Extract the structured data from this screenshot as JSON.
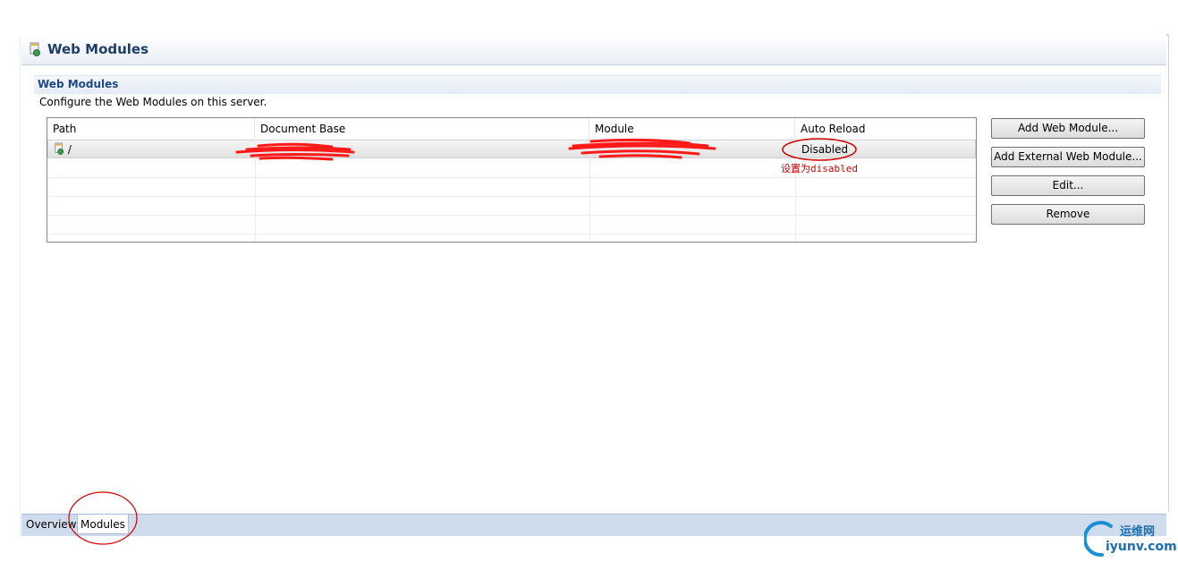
{
  "header": {
    "title": "Web Modules"
  },
  "section": {
    "title": "Web Modules",
    "description": "Configure the Web Modules on this server."
  },
  "table": {
    "columns": [
      "Path",
      "Document Base",
      "Module",
      "Auto Reload"
    ],
    "rows": [
      {
        "path": "/",
        "document_base": "",
        "module": "",
        "auto_reload": "Disabled"
      }
    ]
  },
  "buttons": {
    "add_web_module": "Add Web Module...",
    "add_external_web_module": "Add External Web Module...",
    "edit": "Edit...",
    "remove": "Remove"
  },
  "annotation": {
    "note": "设置为disabled",
    "color": "#cc0000"
  },
  "tabs": [
    "Overview",
    "Modules"
  ],
  "watermark": {
    "cn": "运维网",
    "en": "iyunv.com"
  },
  "colors": {
    "header_title": "#1f3d6b",
    "section_title": "#1f4a87",
    "tabbar": "#cfdced"
  }
}
